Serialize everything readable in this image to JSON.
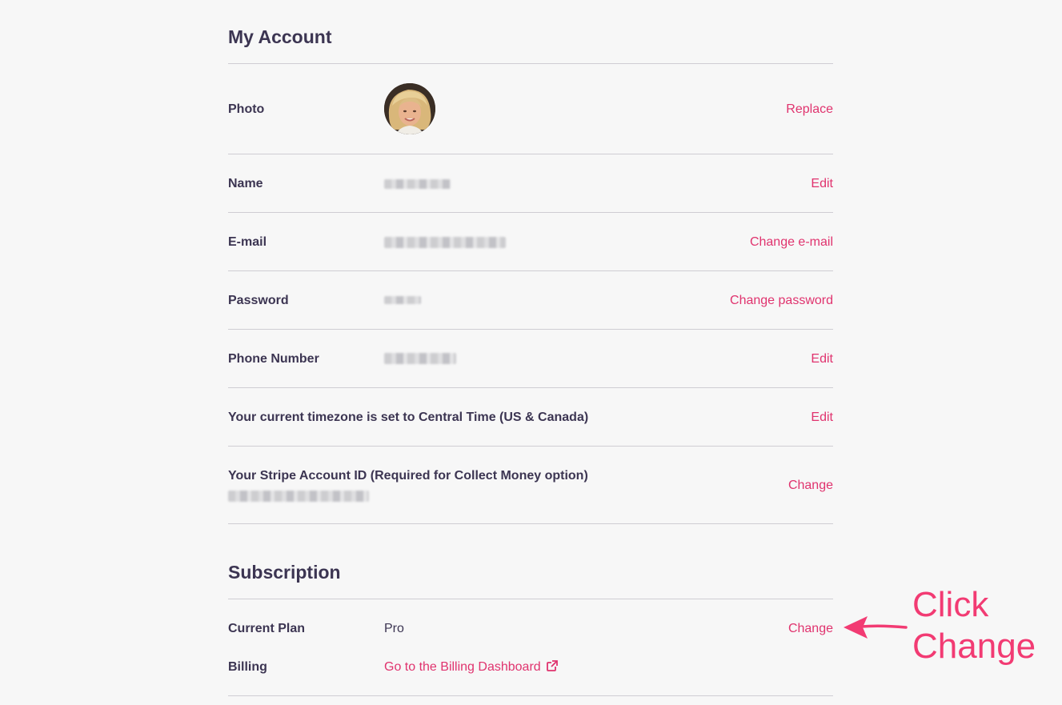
{
  "account": {
    "title": "My Account",
    "photo_label": "Photo",
    "photo_action": "Replace",
    "name_label": "Name",
    "name_action": "Edit",
    "email_label": "E-mail",
    "email_action": "Change e-mail",
    "password_label": "Password",
    "password_action": "Change password",
    "phone_label": "Phone Number",
    "phone_action": "Edit",
    "timezone_label": "Your current timezone is set to Central Time (US & Canada)",
    "timezone_action": "Edit",
    "stripe_label": "Your Stripe Account ID (Required for Collect Money option)",
    "stripe_action": "Change"
  },
  "subscription": {
    "title": "Subscription",
    "plan_label": "Current Plan",
    "plan_value": "Pro",
    "plan_action": "Change",
    "billing_label": "Billing",
    "billing_link": "Go to the Billing Dashboard"
  },
  "annotation": {
    "line1": "Click",
    "line2": "Change",
    "color": "#f23b73"
  },
  "colors": {
    "accent": "#e0336e",
    "text": "#3c3552",
    "background": "#f7f7f7",
    "divider": "#cfcdd3"
  },
  "icons": {
    "external_link": "external-link-icon",
    "arrow": "arrow-left-icon"
  }
}
